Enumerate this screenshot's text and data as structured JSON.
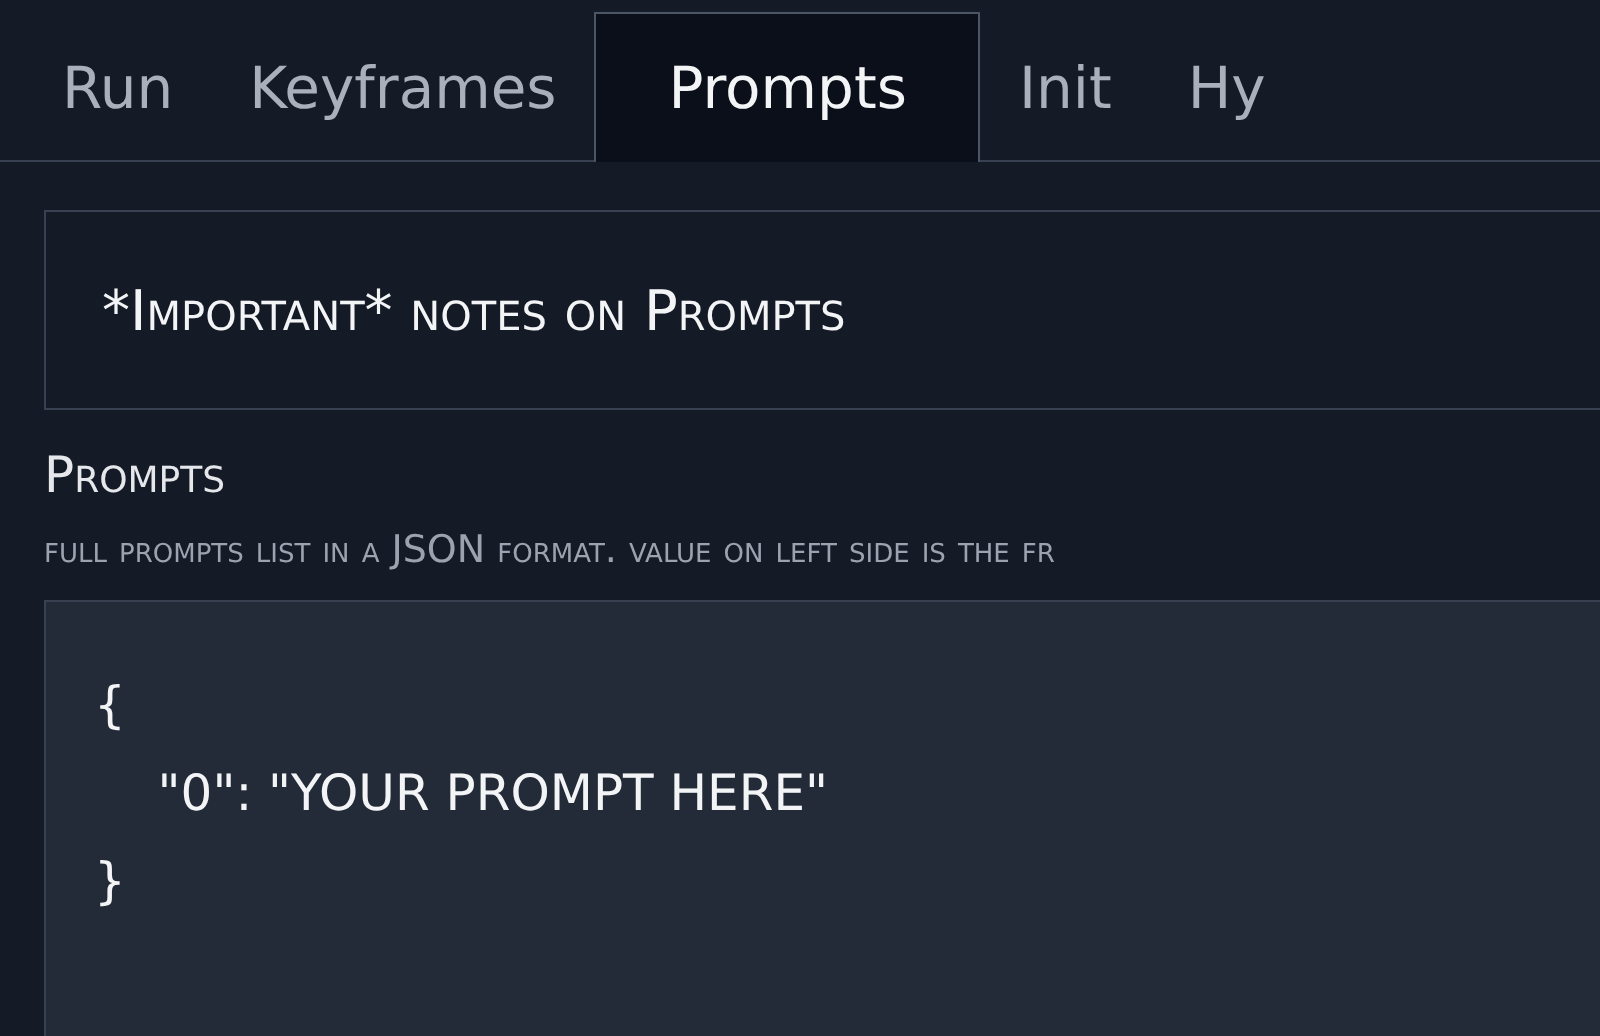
{
  "tabs": [
    {
      "label": "Run",
      "selected": false
    },
    {
      "label": "Keyframes",
      "selected": false
    },
    {
      "label": "Prompts",
      "selected": true
    },
    {
      "label": "Init",
      "selected": false
    },
    {
      "label": "Hy",
      "selected": false
    }
  ],
  "accordion": {
    "title": "*Important* notes on Prompts"
  },
  "prompts_field": {
    "label": "Prompts",
    "description": "full prompts list in a JSON format. value on left side is the fr",
    "lines": [
      "{",
      "    \"0\": \"YOUR PROMPT HERE\"",
      "}"
    ]
  }
}
